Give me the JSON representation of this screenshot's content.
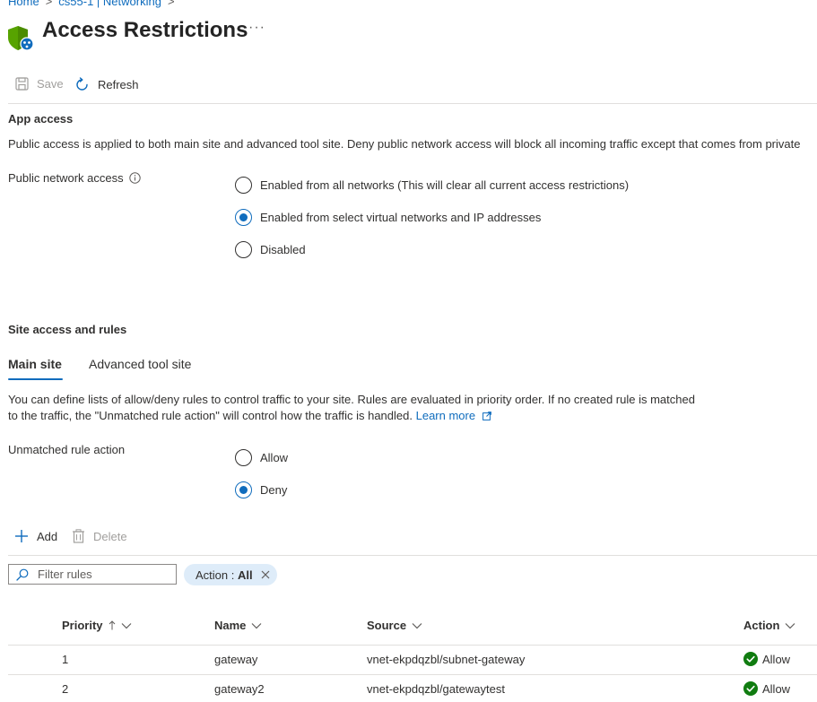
{
  "breadcrumb": {
    "home": "Home",
    "parent": "cs55-1 | Networking"
  },
  "page": {
    "title": "Access Restrictions",
    "more": "···"
  },
  "toolbar": {
    "save_label": "Save",
    "refresh_label": "Refresh"
  },
  "app_access": {
    "heading": "App access",
    "description": "Public access is applied to both main site and advanced tool site. Deny public network access will block all incoming traffic except that comes from private",
    "public_network_label": "Public network access",
    "options": [
      {
        "label": "Enabled from all networks (This will clear all current access restrictions)",
        "selected": false
      },
      {
        "label": "Enabled from select virtual networks and IP addresses",
        "selected": true
      },
      {
        "label": "Disabled",
        "selected": false
      }
    ]
  },
  "site_access": {
    "heading": "Site access and rules",
    "tabs": [
      {
        "label": "Main site",
        "active": true
      },
      {
        "label": "Advanced tool site",
        "active": false
      }
    ],
    "description_line1": "You can define lists of allow/deny rules to control traffic to your site. Rules are evaluated in priority order. If no created rule is matched",
    "description_line2": "to the traffic, the \"Unmatched rule action\" will control how the traffic is handled.",
    "learn_more": "Learn more",
    "unmatched_label": "Unmatched rule action",
    "unmatched_options": [
      {
        "label": "Allow",
        "selected": false
      },
      {
        "label": "Deny",
        "selected": true
      }
    ]
  },
  "rules_toolbar": {
    "add_label": "Add",
    "delete_label": "Delete"
  },
  "filter": {
    "placeholder": "Filter rules",
    "pill_prefix": "Action : ",
    "pill_value": "All"
  },
  "table": {
    "headers": {
      "priority": "Priority",
      "name": "Name",
      "source": "Source",
      "action": "Action"
    },
    "rows": [
      {
        "priority": "1",
        "name": "gateway",
        "source": "vnet-ekpdqzbl/subnet-gateway",
        "action": "Allow"
      },
      {
        "priority": "2",
        "name": "gateway2",
        "source": "vnet-ekpdqzbl/gatewaytest",
        "action": "Allow"
      }
    ]
  },
  "colors": {
    "accent": "#0f6cbd",
    "success": "#107c10",
    "shield": "#57a300",
    "pill_bg": "#deecf9"
  }
}
